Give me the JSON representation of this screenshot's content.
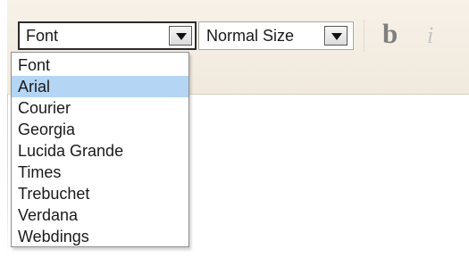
{
  "toolbar": {
    "font_select": {
      "value": "Font",
      "options": [
        "Font",
        "Arial",
        "Courier",
        "Georgia",
        "Lucida Grande",
        "Times",
        "Trebuchet",
        "Verdana",
        "Webdings"
      ],
      "highlighted": "Arial"
    },
    "size_select": {
      "value": "Normal Size"
    },
    "bold_label": "b",
    "italic_label": "i"
  },
  "colors": {
    "toolbar_bg": "#f4ede2",
    "highlight": "#b5d5f5",
    "bold_icon": "#7f7f7f",
    "italic_icon": "#c4c4c4"
  }
}
